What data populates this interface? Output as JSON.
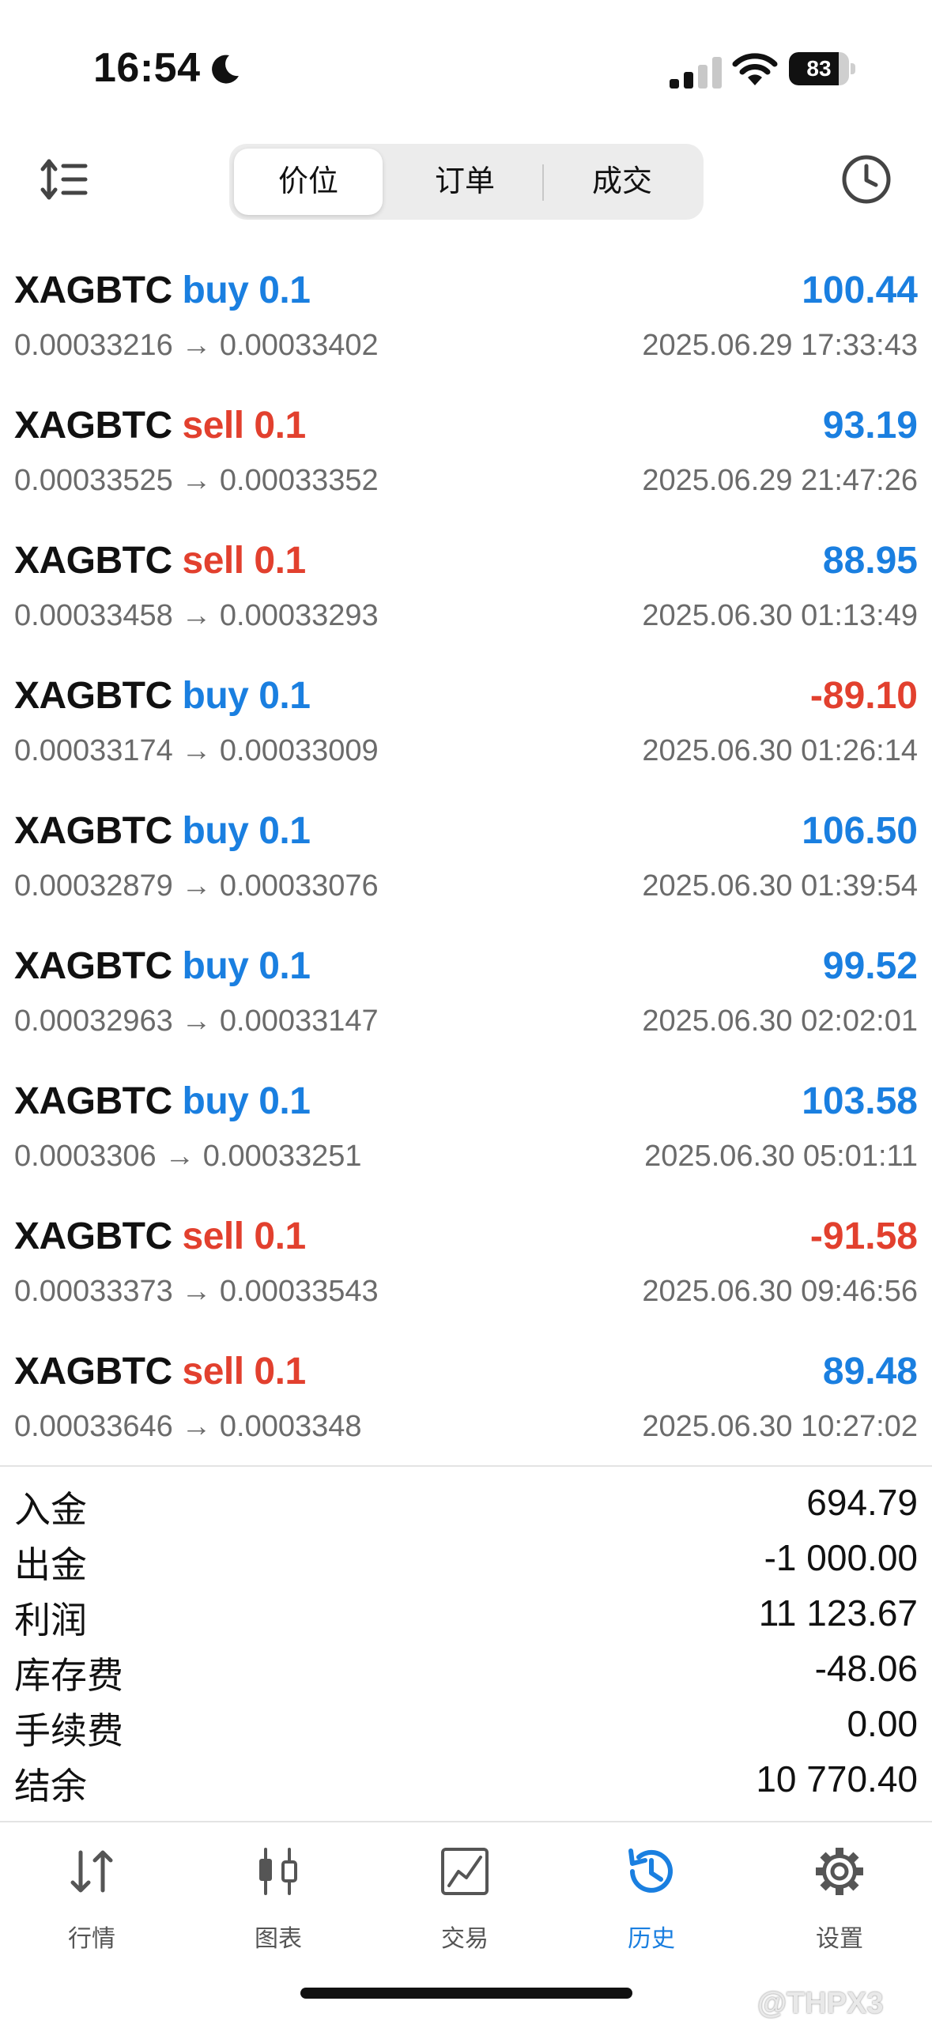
{
  "status_bar": {
    "time": "16:54",
    "battery": "83",
    "battery_level": 0.83
  },
  "segments": [
    "价位",
    "订单",
    "成交"
  ],
  "trades": [
    {
      "symbol": "XAGBTC",
      "side": "buy",
      "volume": "0.1",
      "open": "0.00033216",
      "close": "0.00033402",
      "profit": "100.44",
      "time": "2025.06.29 17:33:43"
    },
    {
      "symbol": "XAGBTC",
      "side": "sell",
      "volume": "0.1",
      "open": "0.00033525",
      "close": "0.00033352",
      "profit": "93.19",
      "time": "2025.06.29 21:47:26"
    },
    {
      "symbol": "XAGBTC",
      "side": "sell",
      "volume": "0.1",
      "open": "0.00033458",
      "close": "0.00033293",
      "profit": "88.95",
      "time": "2025.06.30 01:13:49"
    },
    {
      "symbol": "XAGBTC",
      "side": "buy",
      "volume": "0.1",
      "open": "0.00033174",
      "close": "0.00033009",
      "profit": "-89.10",
      "time": "2025.06.30 01:26:14"
    },
    {
      "symbol": "XAGBTC",
      "side": "buy",
      "volume": "0.1",
      "open": "0.00032879",
      "close": "0.00033076",
      "profit": "106.50",
      "time": "2025.06.30 01:39:54"
    },
    {
      "symbol": "XAGBTC",
      "side": "buy",
      "volume": "0.1",
      "open": "0.00032963",
      "close": "0.00033147",
      "profit": "99.52",
      "time": "2025.06.30 02:02:01"
    },
    {
      "symbol": "XAGBTC",
      "side": "buy",
      "volume": "0.1",
      "open": "0.0003306",
      "close": "0.00033251",
      "profit": "103.58",
      "time": "2025.06.30 05:01:11"
    },
    {
      "symbol": "XAGBTC",
      "side": "sell",
      "volume": "0.1",
      "open": "0.00033373",
      "close": "0.00033543",
      "profit": "-91.58",
      "time": "2025.06.30 09:46:56"
    },
    {
      "symbol": "XAGBTC",
      "side": "sell",
      "volume": "0.1",
      "open": "0.00033646",
      "close": "0.0003348",
      "profit": "89.48",
      "time": "2025.06.30 10:27:02"
    }
  ],
  "arrow": "→",
  "summary": [
    {
      "label": "入金",
      "value": "694.79"
    },
    {
      "label": "出金",
      "value": "-1 000.00"
    },
    {
      "label": "利润",
      "value": "11 123.67"
    },
    {
      "label": "库存费",
      "value": "-48.06"
    },
    {
      "label": "手续费",
      "value": "0.00"
    },
    {
      "label": "结余",
      "value": "10 770.40"
    }
  ],
  "tabs": [
    {
      "label": "行情",
      "icon": "quotes-icon"
    },
    {
      "label": "图表",
      "icon": "chart-icon"
    },
    {
      "label": "交易",
      "icon": "trade-icon"
    },
    {
      "label": "历史",
      "icon": "history-icon",
      "active": true
    },
    {
      "label": "设置",
      "icon": "settings-icon"
    }
  ],
  "watermark": "@THPX3",
  "colors": {
    "buy": "#1a7fe0",
    "sell": "#e2402e",
    "accent": "#1a7fe0"
  }
}
